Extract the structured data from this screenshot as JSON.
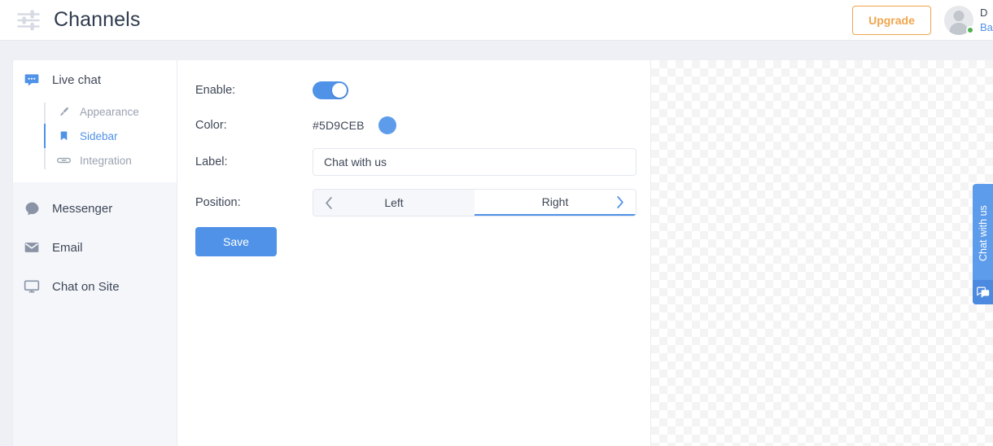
{
  "topbar": {
    "icon": "sliders-icon",
    "title": "Channels",
    "upgrade_label": "Upgrade",
    "user": {
      "avatar": "avatar-placeholder-icon",
      "presence": "online",
      "name": "D",
      "role": "Ba"
    }
  },
  "nav": {
    "items": [
      {
        "label": "Live chat",
        "icon": "chat-bubble-icon",
        "active": true
      },
      {
        "label": "Messenger",
        "icon": "messenger-bubble-icon",
        "active": false
      },
      {
        "label": "Email",
        "icon": "envelope-icon",
        "active": false
      },
      {
        "label": "Chat on Site",
        "icon": "monitor-icon",
        "active": false
      }
    ],
    "subitems": [
      {
        "label": "Appearance",
        "icon": "paintbrush-icon",
        "active": false
      },
      {
        "label": "Sidebar",
        "icon": "bookmark-icon",
        "active": true
      },
      {
        "label": "Integration",
        "icon": "link-icon",
        "active": false
      }
    ]
  },
  "form": {
    "enable": {
      "label": "Enable:",
      "value": "on"
    },
    "color": {
      "label": "Color:",
      "value": "#5D9CEB"
    },
    "label_field": {
      "label": "Label:",
      "value": "Chat with us",
      "placeholder": "Chat with us"
    },
    "position": {
      "label": "Position:",
      "options": [
        "Left",
        "Right"
      ],
      "selected": "Right",
      "prev_icon": "chevron-left-icon",
      "next_icon": "chevron-right-icon"
    },
    "save_label": "Save"
  },
  "preview": {
    "tab_text": "Chat with us",
    "tab_icon": "chat-bubbles-icon",
    "tab_color": "#5D9CEB"
  }
}
